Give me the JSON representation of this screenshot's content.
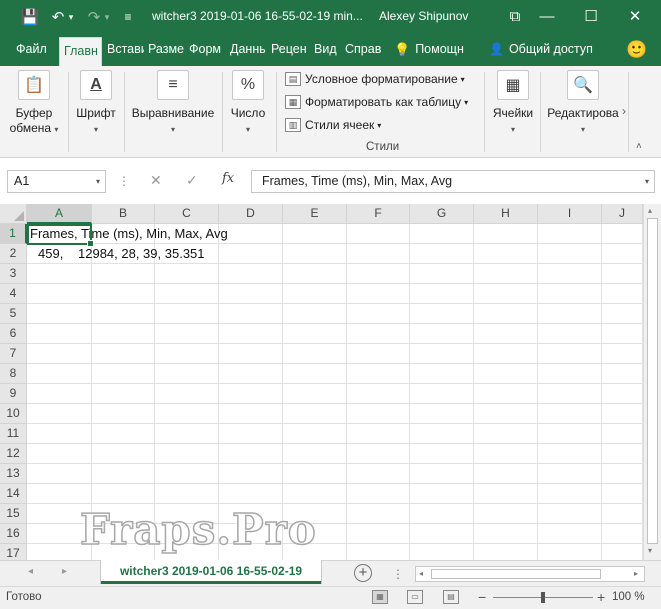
{
  "titlebar": {
    "title": "witcher3 2019-01-06 16-55-02-19 min...",
    "user": "Alexey Shipunov",
    "save_icon": "💾",
    "undo_icon": "↶",
    "undo_caret": "▾",
    "redo_icon": "↷",
    "redo_caret": "▾",
    "customize_icon": "≡",
    "restore_icon": "⧉",
    "minimize_icon": "—",
    "maximize_icon": "☐",
    "close_icon": "✕",
    "bg_color": "#217346"
  },
  "tabs": [
    {
      "label": "Файл",
      "active": false
    },
    {
      "label": "Главн",
      "active": true
    },
    {
      "label": "Встави",
      "active": false
    },
    {
      "label": "Разме",
      "active": false
    },
    {
      "label": "Форм",
      "active": false
    },
    {
      "label": "Данны",
      "active": false
    },
    {
      "label": "Рецен",
      "active": false
    },
    {
      "label": "Вид",
      "active": false
    },
    {
      "label": "Справ",
      "active": false
    }
  ],
  "tabs_right": {
    "tell_me_icon": "💡",
    "tell_me": "Помощн",
    "share_icon": "👤",
    "share": "Общий доступ",
    "smiley_icon": "🙂"
  },
  "ribbon": {
    "clipboard": {
      "label1": "Буфер",
      "label2": "обмена",
      "icon": "📋"
    },
    "font": {
      "label": "Шрифт",
      "icon": "A"
    },
    "alignment": {
      "label": "Выравнивание",
      "icon": "≡"
    },
    "number": {
      "label": "Число",
      "icon": "%"
    },
    "styles": {
      "conditional": "Условное форматирование",
      "format_table": "Форматировать как таблицу",
      "cell_styles": "Стили ячеек",
      "group_label": "Стили"
    },
    "cells": {
      "label": "Ячейки",
      "icon": "▦"
    },
    "editing": {
      "label": "Редактирова",
      "icon": "🔍"
    },
    "caret": "▾",
    "scroll_right": "›",
    "collapse_icon": "˄"
  },
  "formula_bar": {
    "name_box": "A1",
    "dropdown_icon": "▾",
    "dots": "⋮",
    "cancel_icon": "✕",
    "enter_icon": "✓",
    "fx_label": "fx",
    "formula": "Frames, Time (ms), Min, Max, Avg"
  },
  "columns": [
    "A",
    "B",
    "C",
    "D",
    "E",
    "F",
    "G",
    "H",
    "I",
    "J"
  ],
  "rows": [
    "1",
    "2",
    "3",
    "4",
    "5",
    "6",
    "7",
    "8",
    "9",
    "10",
    "11",
    "12",
    "13",
    "14",
    "15",
    "16",
    "17"
  ],
  "cells": {
    "A1": "Frames, Time (ms), Min, Max, Avg",
    "A2": "459,",
    "B2": "12984,  28,  39, 35.351"
  },
  "active_cell": "A1",
  "sheet": {
    "tab_name": "witcher3 2019-01-06 16-55-02-19",
    "add_icon": "+",
    "nav_prev": "◂",
    "nav_next": "▸",
    "more": "⋮"
  },
  "scroll": {
    "up": "▴",
    "down": "▾",
    "left": "◂",
    "right": "▸"
  },
  "statusbar": {
    "ready": "Готово",
    "view_normal_icon": "▦",
    "view_layout_icon": "▭",
    "view_break_icon": "▤",
    "zoom_minus": "−",
    "zoom_plus": "+",
    "zoom": "100 %",
    "zoom_fraction": 0.5
  },
  "watermark": "Fraps.Pro"
}
